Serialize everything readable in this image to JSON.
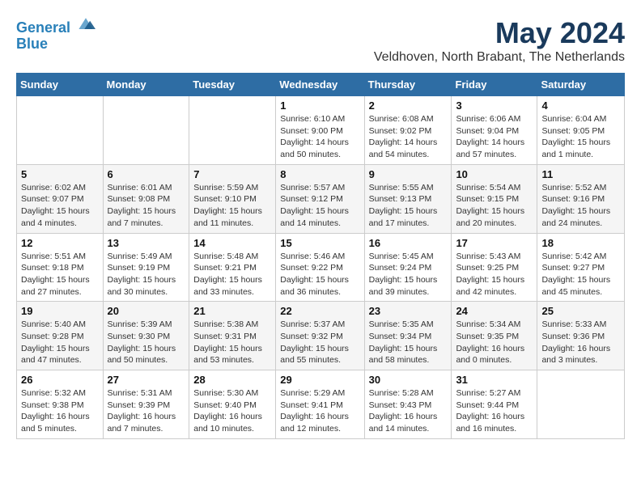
{
  "logo": {
    "line1": "General",
    "line2": "Blue"
  },
  "title": "May 2024",
  "location": "Veldhoven, North Brabant, The Netherlands",
  "weekdays": [
    "Sunday",
    "Monday",
    "Tuesday",
    "Wednesday",
    "Thursday",
    "Friday",
    "Saturday"
  ],
  "weeks": [
    [
      {
        "day": "",
        "info": ""
      },
      {
        "day": "",
        "info": ""
      },
      {
        "day": "",
        "info": ""
      },
      {
        "day": "1",
        "info": "Sunrise: 6:10 AM\nSunset: 9:00 PM\nDaylight: 14 hours\nand 50 minutes."
      },
      {
        "day": "2",
        "info": "Sunrise: 6:08 AM\nSunset: 9:02 PM\nDaylight: 14 hours\nand 54 minutes."
      },
      {
        "day": "3",
        "info": "Sunrise: 6:06 AM\nSunset: 9:04 PM\nDaylight: 14 hours\nand 57 minutes."
      },
      {
        "day": "4",
        "info": "Sunrise: 6:04 AM\nSunset: 9:05 PM\nDaylight: 15 hours\nand 1 minute."
      }
    ],
    [
      {
        "day": "5",
        "info": "Sunrise: 6:02 AM\nSunset: 9:07 PM\nDaylight: 15 hours\nand 4 minutes."
      },
      {
        "day": "6",
        "info": "Sunrise: 6:01 AM\nSunset: 9:08 PM\nDaylight: 15 hours\nand 7 minutes."
      },
      {
        "day": "7",
        "info": "Sunrise: 5:59 AM\nSunset: 9:10 PM\nDaylight: 15 hours\nand 11 minutes."
      },
      {
        "day": "8",
        "info": "Sunrise: 5:57 AM\nSunset: 9:12 PM\nDaylight: 15 hours\nand 14 minutes."
      },
      {
        "day": "9",
        "info": "Sunrise: 5:55 AM\nSunset: 9:13 PM\nDaylight: 15 hours\nand 17 minutes."
      },
      {
        "day": "10",
        "info": "Sunrise: 5:54 AM\nSunset: 9:15 PM\nDaylight: 15 hours\nand 20 minutes."
      },
      {
        "day": "11",
        "info": "Sunrise: 5:52 AM\nSunset: 9:16 PM\nDaylight: 15 hours\nand 24 minutes."
      }
    ],
    [
      {
        "day": "12",
        "info": "Sunrise: 5:51 AM\nSunset: 9:18 PM\nDaylight: 15 hours\nand 27 minutes."
      },
      {
        "day": "13",
        "info": "Sunrise: 5:49 AM\nSunset: 9:19 PM\nDaylight: 15 hours\nand 30 minutes."
      },
      {
        "day": "14",
        "info": "Sunrise: 5:48 AM\nSunset: 9:21 PM\nDaylight: 15 hours\nand 33 minutes."
      },
      {
        "day": "15",
        "info": "Sunrise: 5:46 AM\nSunset: 9:22 PM\nDaylight: 15 hours\nand 36 minutes."
      },
      {
        "day": "16",
        "info": "Sunrise: 5:45 AM\nSunset: 9:24 PM\nDaylight: 15 hours\nand 39 minutes."
      },
      {
        "day": "17",
        "info": "Sunrise: 5:43 AM\nSunset: 9:25 PM\nDaylight: 15 hours\nand 42 minutes."
      },
      {
        "day": "18",
        "info": "Sunrise: 5:42 AM\nSunset: 9:27 PM\nDaylight: 15 hours\nand 45 minutes."
      }
    ],
    [
      {
        "day": "19",
        "info": "Sunrise: 5:40 AM\nSunset: 9:28 PM\nDaylight: 15 hours\nand 47 minutes."
      },
      {
        "day": "20",
        "info": "Sunrise: 5:39 AM\nSunset: 9:30 PM\nDaylight: 15 hours\nand 50 minutes."
      },
      {
        "day": "21",
        "info": "Sunrise: 5:38 AM\nSunset: 9:31 PM\nDaylight: 15 hours\nand 53 minutes."
      },
      {
        "day": "22",
        "info": "Sunrise: 5:37 AM\nSunset: 9:32 PM\nDaylight: 15 hours\nand 55 minutes."
      },
      {
        "day": "23",
        "info": "Sunrise: 5:35 AM\nSunset: 9:34 PM\nDaylight: 15 hours\nand 58 minutes."
      },
      {
        "day": "24",
        "info": "Sunrise: 5:34 AM\nSunset: 9:35 PM\nDaylight: 16 hours\nand 0 minutes."
      },
      {
        "day": "25",
        "info": "Sunrise: 5:33 AM\nSunset: 9:36 PM\nDaylight: 16 hours\nand 3 minutes."
      }
    ],
    [
      {
        "day": "26",
        "info": "Sunrise: 5:32 AM\nSunset: 9:38 PM\nDaylight: 16 hours\nand 5 minutes."
      },
      {
        "day": "27",
        "info": "Sunrise: 5:31 AM\nSunset: 9:39 PM\nDaylight: 16 hours\nand 7 minutes."
      },
      {
        "day": "28",
        "info": "Sunrise: 5:30 AM\nSunset: 9:40 PM\nDaylight: 16 hours\nand 10 minutes."
      },
      {
        "day": "29",
        "info": "Sunrise: 5:29 AM\nSunset: 9:41 PM\nDaylight: 16 hours\nand 12 minutes."
      },
      {
        "day": "30",
        "info": "Sunrise: 5:28 AM\nSunset: 9:43 PM\nDaylight: 16 hours\nand 14 minutes."
      },
      {
        "day": "31",
        "info": "Sunrise: 5:27 AM\nSunset: 9:44 PM\nDaylight: 16 hours\nand 16 minutes."
      },
      {
        "day": "",
        "info": ""
      }
    ]
  ]
}
